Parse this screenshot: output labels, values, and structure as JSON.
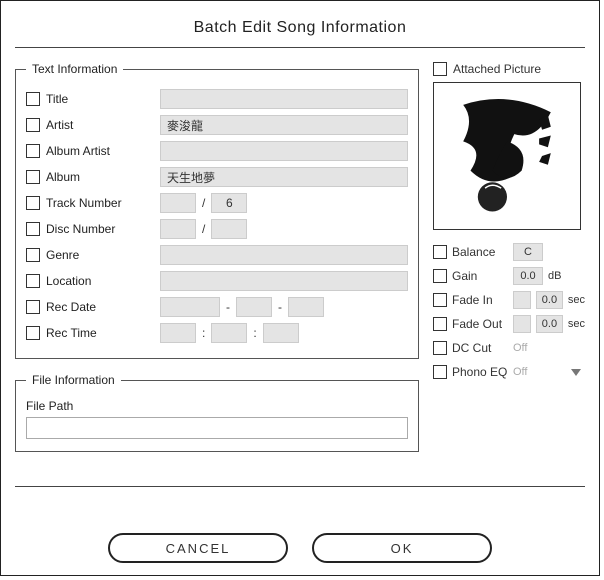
{
  "dialog": {
    "title": "Batch Edit Song Information",
    "cancel_label": "CANCEL",
    "ok_label": "OK"
  },
  "text_info": {
    "legend": "Text Information",
    "fields": {
      "title": {
        "label": "Title",
        "value": ""
      },
      "artist": {
        "label": "Artist",
        "value": "麥浚龍"
      },
      "album_artist": {
        "label": "Album Artist",
        "value": ""
      },
      "album": {
        "label": "Album",
        "value": "天生地夢"
      },
      "track_number": {
        "label": "Track Number",
        "a": "",
        "b": "6"
      },
      "disc_number": {
        "label": "Disc Number",
        "a": "",
        "b": ""
      },
      "genre": {
        "label": "Genre",
        "value": ""
      },
      "location": {
        "label": "Location",
        "value": ""
      },
      "rec_date": {
        "label": "Rec Date",
        "y": "",
        "m": "",
        "d": ""
      },
      "rec_time": {
        "label": "Rec Time",
        "h": "",
        "mi": "",
        "s": ""
      }
    }
  },
  "file_info": {
    "legend": "File Information",
    "path_label": "File Path",
    "path_value": ""
  },
  "attached": {
    "label": "Attached Picture"
  },
  "params": {
    "balance": {
      "label": "Balance",
      "value": "C"
    },
    "gain": {
      "label": "Gain",
      "value": "0.0",
      "unit": "dB"
    },
    "fade_in": {
      "label": "Fade In",
      "enabled": "",
      "value": "0.0",
      "unit": "sec"
    },
    "fade_out": {
      "label": "Fade Out",
      "enabled": "",
      "value": "0.0",
      "unit": "sec"
    },
    "dc_cut": {
      "label": "DC Cut",
      "state": "Off"
    },
    "phono_eq": {
      "label": "Phono EQ",
      "state": "Off"
    }
  }
}
